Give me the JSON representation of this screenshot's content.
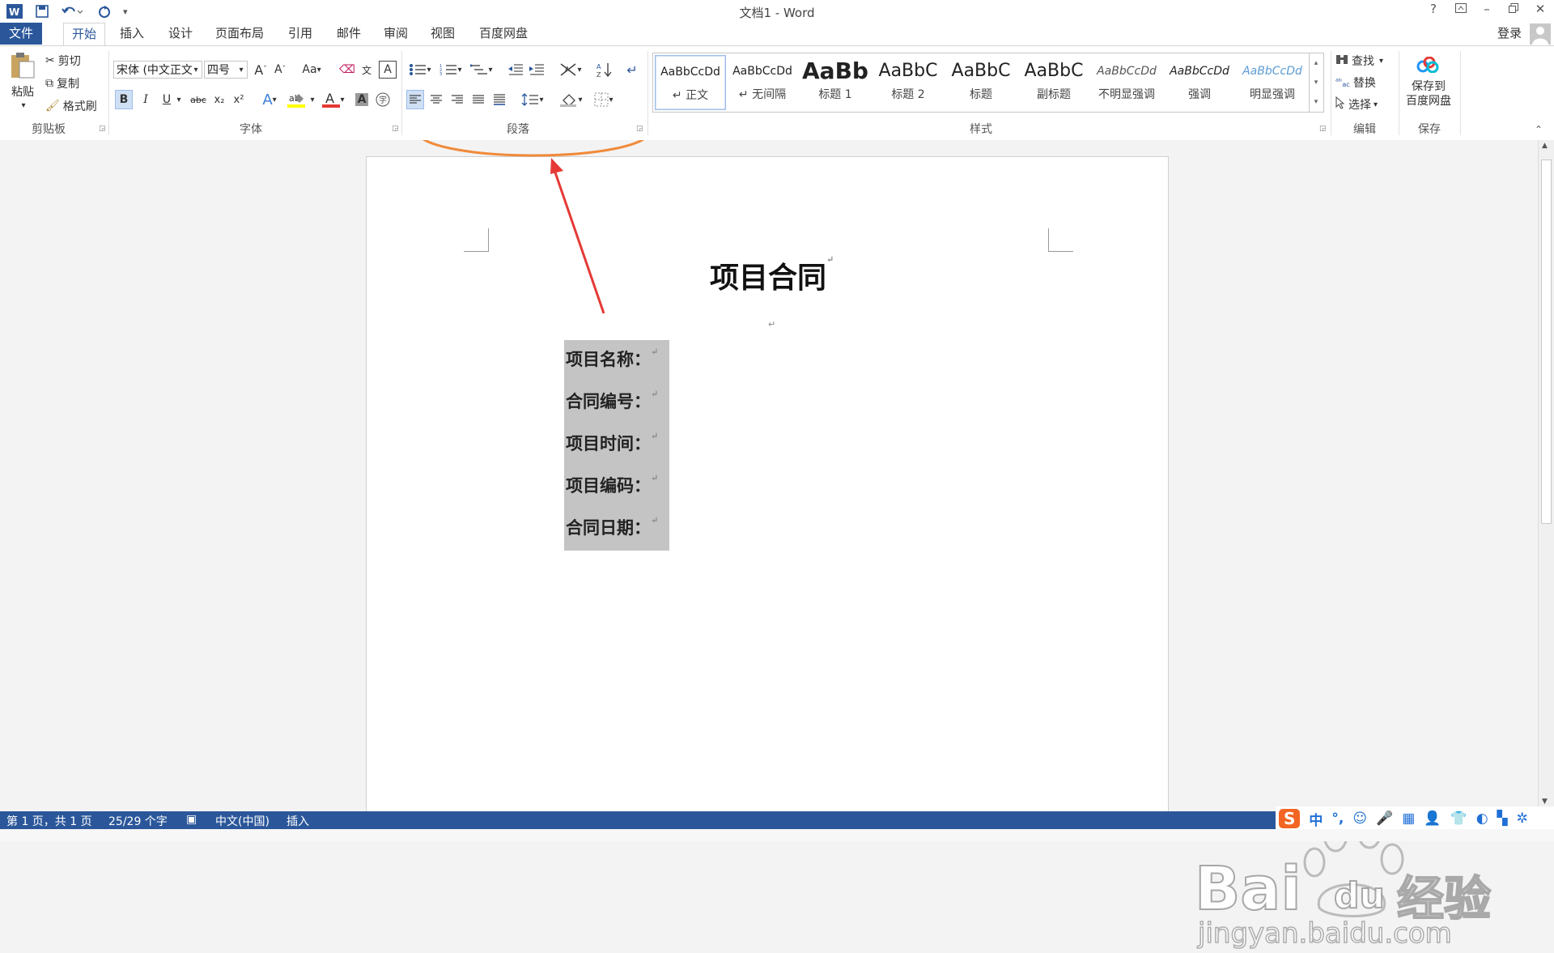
{
  "window": {
    "title": "文档1 - Word",
    "help": "?",
    "login": "登录"
  },
  "tabs": [
    "文件",
    "开始",
    "插入",
    "设计",
    "页面布局",
    "引用",
    "邮件",
    "审阅",
    "视图",
    "百度网盘"
  ],
  "ribbon": {
    "clipboard": {
      "paste": "粘贴",
      "cut": "剪切",
      "copy": "复制",
      "format_painter": "格式刷",
      "label": "剪贴板"
    },
    "font": {
      "font_name": "宋体 (中文正文",
      "font_size": "四号",
      "case_btn": "Aa",
      "bold": "B",
      "italic": "I",
      "underline": "U",
      "strike": "abc",
      "sub": "x₂",
      "sup": "x²",
      "label": "字体"
    },
    "paragraph": {
      "label": "段落"
    },
    "styles": {
      "label": "样式",
      "items": [
        {
          "sample": "AaBbCcDd",
          "name": "↵ 正文"
        },
        {
          "sample": "AaBbCcDd",
          "name": "↵ 无间隔"
        },
        {
          "sample": "AaBb",
          "name": "标题 1"
        },
        {
          "sample": "AaBbC",
          "name": "标题 2"
        },
        {
          "sample": "AaBbC",
          "name": "标题"
        },
        {
          "sample": "AaBbC",
          "name": "副标题"
        },
        {
          "sample": "AaBbCcDd",
          "name": "不明显强调"
        },
        {
          "sample": "AaBbCcDd",
          "name": "强调"
        },
        {
          "sample": "AaBbCcDd",
          "name": "明显强调"
        }
      ]
    },
    "editing": {
      "find": "查找",
      "replace": "替换",
      "select": "选择",
      "label": "编辑"
    },
    "save": {
      "line1": "保存到",
      "line2": "百度网盘",
      "label": "保存"
    }
  },
  "document": {
    "title": "项目合同",
    "fields": [
      "项目名称：",
      "合同编号：",
      "项目时间：",
      "项目编码：",
      "合同日期："
    ]
  },
  "status": {
    "page": "第 1 页，共 1 页",
    "words": "25/29 个字",
    "lang": "中文(中国)",
    "mode": "插入"
  },
  "tray": [
    "S",
    "中",
    "°,",
    "☺",
    "🎤",
    "▦",
    "👤",
    "👕",
    "◐",
    "▚",
    "✲"
  ],
  "watermark": {
    "line1": "Bai",
    "paw": "du",
    "cn": "经验",
    "url": "jingyan.baidu.com"
  },
  "colors": {
    "accent": "#2b579a",
    "annotation_orange": "#f08a3a",
    "annotation_red": "#e53935",
    "selection": "#c4c4c4"
  }
}
